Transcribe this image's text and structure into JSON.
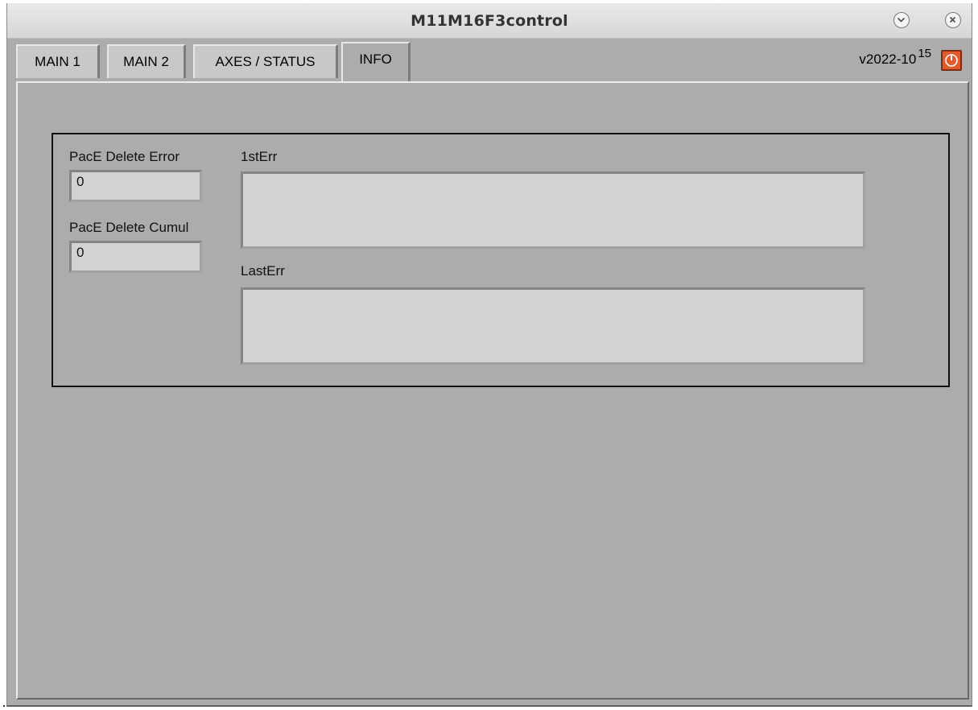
{
  "window": {
    "title": "M11M16F3control",
    "minimize_icon": "chevron-down-icon",
    "close_icon": "close-icon"
  },
  "tabs": [
    {
      "label": "MAIN 1",
      "active": false
    },
    {
      "label": "MAIN 2",
      "active": false
    },
    {
      "label": "AXES / STATUS",
      "active": false
    },
    {
      "label": "INFO",
      "active": true
    }
  ],
  "header": {
    "version": "v2022-10",
    "version_sup": "15",
    "power_icon": "power-icon",
    "power_color": "#e25b2a"
  },
  "info": {
    "pace_delete_error_label": "PacE Delete Error",
    "pace_delete_error_value": "0",
    "pace_delete_cumul_label": "PacE Delete Cumul",
    "pace_delete_cumul_value": "0",
    "first_error_label": "1stErr",
    "first_error_value": "",
    "last_error_label": "LastErr",
    "last_error_value": ""
  }
}
